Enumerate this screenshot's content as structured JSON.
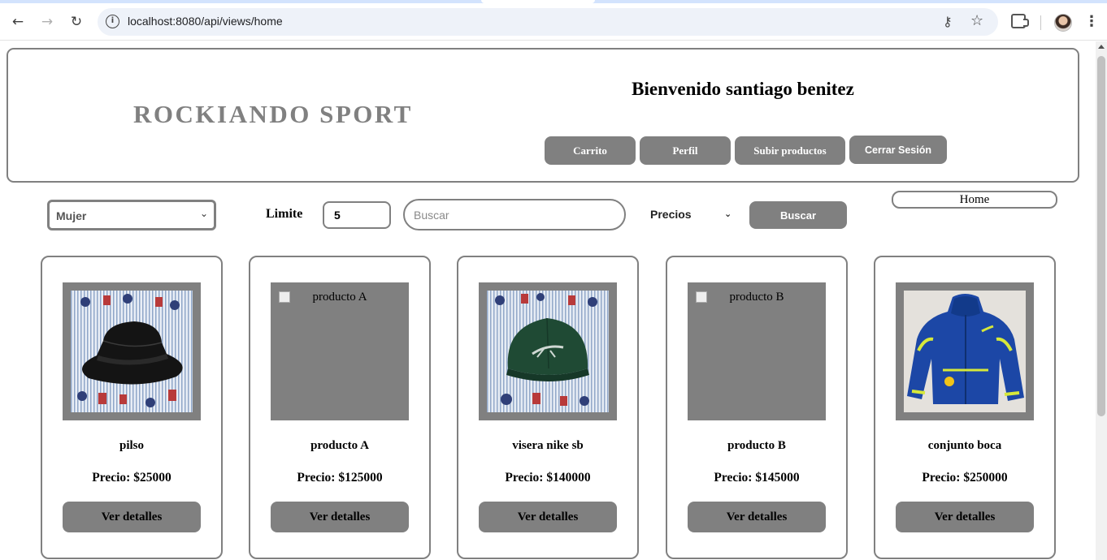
{
  "browser": {
    "url": "localhost:8080/api/views/home"
  },
  "header": {
    "brand": "ROCKIANDO SPORT",
    "welcome_prefix": "Bienvenido",
    "user_name": "santiago benitez",
    "buttons": {
      "cart": "Carrito",
      "profile": "Perfil",
      "upload": "Subir productos",
      "logout": "Cerrar Sesión"
    }
  },
  "filters": {
    "category_selected": "Mujer",
    "limit_label": "Limite",
    "limit_value": "5",
    "search_placeholder": "Buscar",
    "price_selected": "Precios",
    "search_button": "Buscar",
    "home_button": "Home"
  },
  "products": [
    {
      "name": "pilso",
      "price": "Precio: $25000",
      "image": "bucket-hat-photo",
      "alt": "",
      "details": "Ver detalles"
    },
    {
      "name": "producto A",
      "price": "Precio: $125000",
      "image": "broken",
      "alt": "producto A",
      "details": "Ver detalles"
    },
    {
      "name": "visera nike sb",
      "price": "Precio: $140000",
      "image": "green-cap-photo",
      "alt": "",
      "details": "Ver detalles"
    },
    {
      "name": "producto B",
      "price": "Precio: $145000",
      "image": "broken",
      "alt": "producto B",
      "details": "Ver detalles"
    },
    {
      "name": "conjunto boca",
      "price": "Precio: $250000",
      "image": "blue-jacket-photo",
      "alt": "",
      "details": "Ver detalles"
    }
  ],
  "colors": {
    "accent_gray": "#808080",
    "chrome_blue": "#d3e3fd",
    "omnibox": "#eef2f9"
  }
}
